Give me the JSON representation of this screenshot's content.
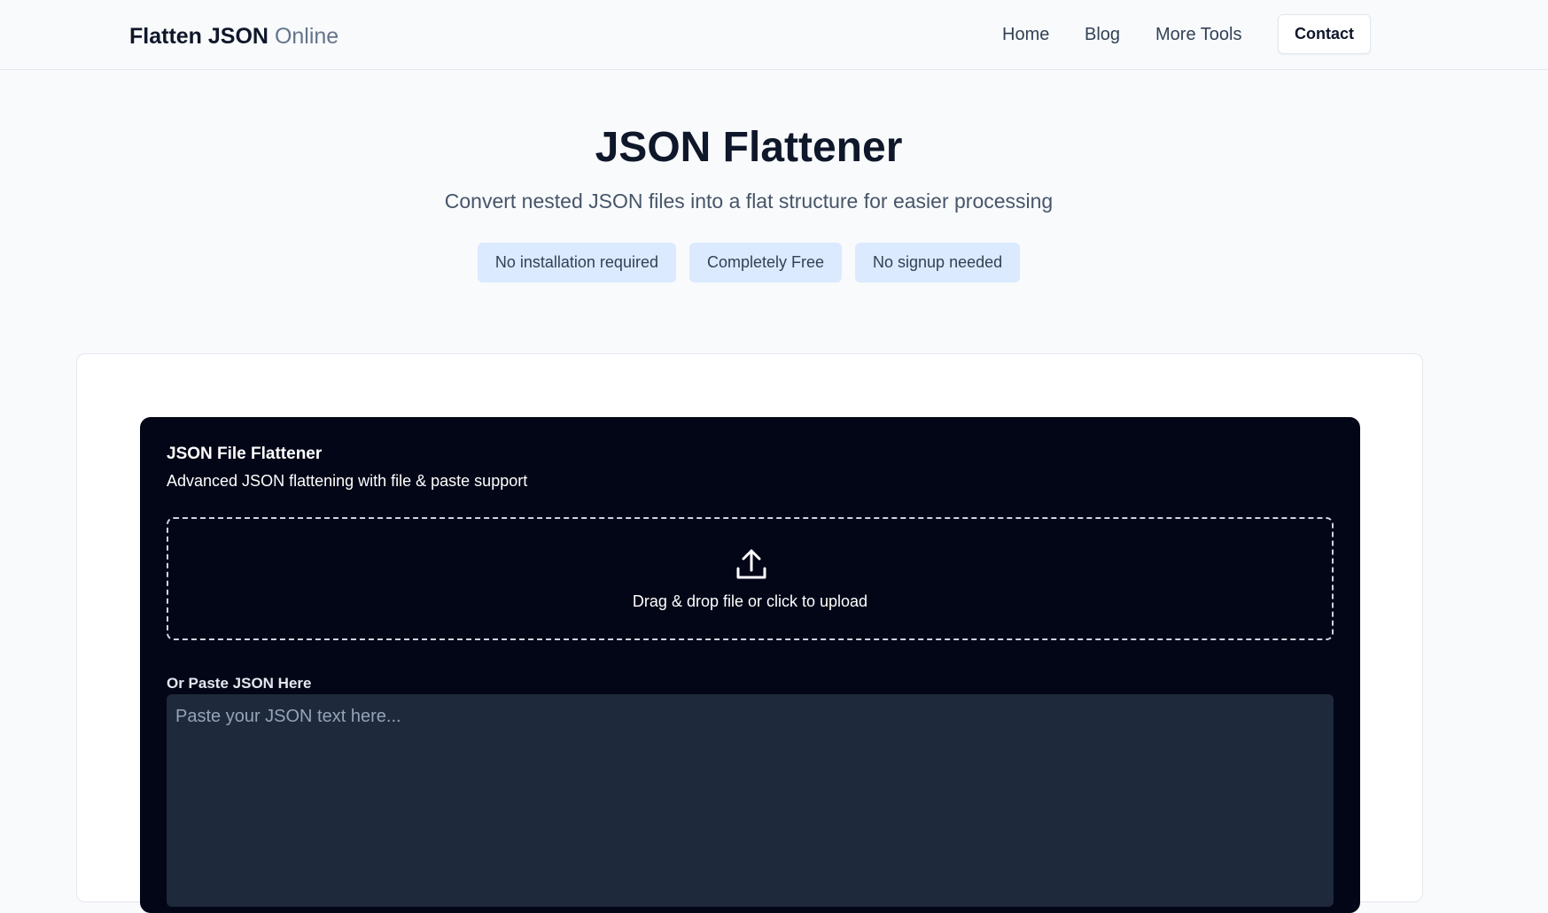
{
  "header": {
    "logo": {
      "bold": "Flatten JSON",
      "light": "Online"
    },
    "nav": {
      "home": "Home",
      "blog": "Blog",
      "more_tools": "More Tools"
    },
    "contact_label": "Contact"
  },
  "hero": {
    "title": "JSON Flattener",
    "subtitle": "Convert nested JSON files into a flat structure for easier processing",
    "badges": [
      "No installation required",
      "Completely Free",
      "No signup needed"
    ]
  },
  "tool": {
    "title": "JSON File Flattener",
    "subtitle": "Advanced JSON flattening with file & paste support",
    "dropzone": {
      "icon": "upload-icon",
      "text": "Drag & drop file or click to upload"
    },
    "paste": {
      "label": "Or Paste JSON Here",
      "placeholder": "Paste your JSON text here...",
      "value": ""
    }
  },
  "colors": {
    "page_bg": "#f8fafc",
    "badge_bg": "#dbeafe",
    "panel_bg": "#020617",
    "textarea_bg": "#1e293b"
  }
}
